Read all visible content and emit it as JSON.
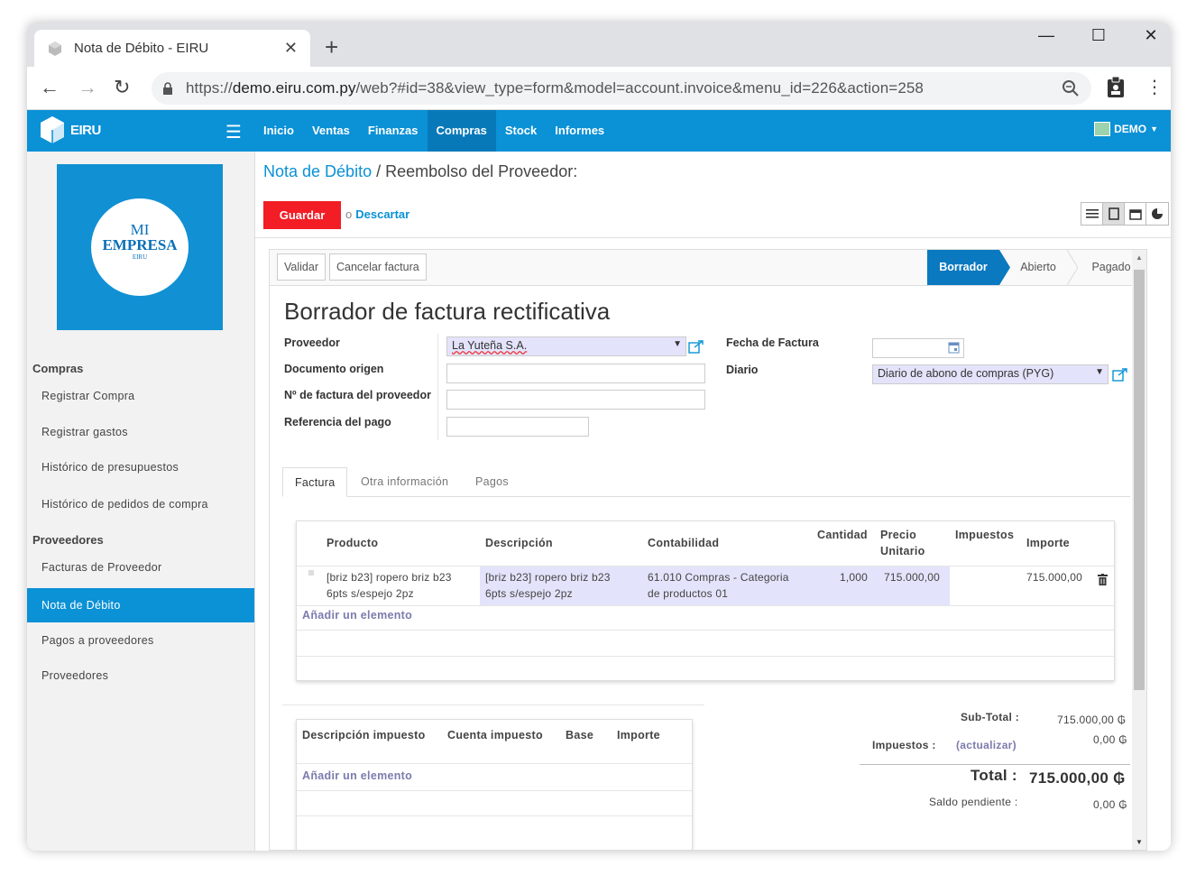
{
  "browser": {
    "tab_title": "Nota de Débito - EIRU",
    "url_prefix": "https://",
    "url_domain": "demo.eiru.com.py",
    "url_path": "/web?#id=38&view_type=form&model=account.invoice&menu_id=226&action=258"
  },
  "app": {
    "logo_text": "EIRU",
    "menus": [
      "Inicio",
      "Ventas",
      "Finanzas",
      "Compras",
      "Stock",
      "Informes"
    ],
    "active_menu": "Compras",
    "user": "DEMO",
    "accent": "#0a91d6"
  },
  "company_logo": {
    "line1": "MI",
    "line2": "EMPRESA",
    "line3": "EIRU"
  },
  "sidebar": {
    "sections": [
      {
        "title": "Compras",
        "items": [
          "Registrar Compra",
          "Registrar gastos",
          "Histórico de presupuestos",
          "Histórico de pedidos de compra"
        ]
      },
      {
        "title": "Proveedores",
        "items": [
          "Facturas de Proveedor",
          "Nota de Débito",
          "Pagos a proveedores",
          "Proveedores"
        ]
      }
    ],
    "active_item": "Nota de Débito"
  },
  "breadcrumb": {
    "link": "Nota de Débito",
    "sep": " / ",
    "current": "Reembolso del Proveedor:"
  },
  "actions": {
    "save": "Guardar",
    "or": "o",
    "discard": "Descartar"
  },
  "statusbar": {
    "buttons": [
      "Validar",
      "Cancelar factura"
    ],
    "stages": [
      "Borrador",
      "Abierto",
      "Pagado"
    ],
    "current_stage": "Borrador"
  },
  "form": {
    "title": "Borrador de factura rectificativa",
    "proveedor_label": "Proveedor",
    "proveedor_value": "La Yuteña S.A.",
    "doc_origen_label": "Documento origen",
    "nro_factura_label": "Nº de factura del proveedor",
    "ref_pago_label": "Referencia del pago",
    "fecha_label": "Fecha de Factura",
    "diario_label": "Diario",
    "diario_value": "Diario de abono de compras (PYG)"
  },
  "form_tabs": [
    "Factura",
    "Otra información",
    "Pagos"
  ],
  "lines": {
    "headers": {
      "producto": "Producto",
      "descripcion": "Descripción",
      "contabilidad": "Contabilidad",
      "cantidad": "Cantidad",
      "precio1": "Precio",
      "precio2": "Unitario",
      "impuestos": "Impuestos",
      "importe": "Importe"
    },
    "rows": [
      {
        "producto1": "[briz b23] ropero briz b23",
        "producto2": "6pts s/espejo 2pz",
        "desc1": "[briz b23] ropero briz b23",
        "desc2": "6pts s/espejo 2pz",
        "cuenta1": "61.010 Compras - Categoria",
        "cuenta2": "de productos 01",
        "cantidad": "1,000",
        "precio": "715.000,00",
        "impuestos": "",
        "importe": "715.000,00"
      }
    ],
    "add": "Añadir un elemento"
  },
  "taxes": {
    "headers": {
      "desc": "Descripción impuesto",
      "cuenta": "Cuenta impuesto",
      "base": "Base",
      "importe": "Importe"
    },
    "add": "Añadir un elemento"
  },
  "totals": {
    "subtotal_label": "Sub-Total :",
    "subtotal": "715.000,00 ₲",
    "impuestos_label": "Impuestos :",
    "actualizar": "(actualizar)",
    "impuestos": "0,00 ₲",
    "total_label": "Total :",
    "total": "715.000,00 ₲",
    "saldo_label": "Saldo pendiente :",
    "saldo": "0,00 ₲"
  }
}
